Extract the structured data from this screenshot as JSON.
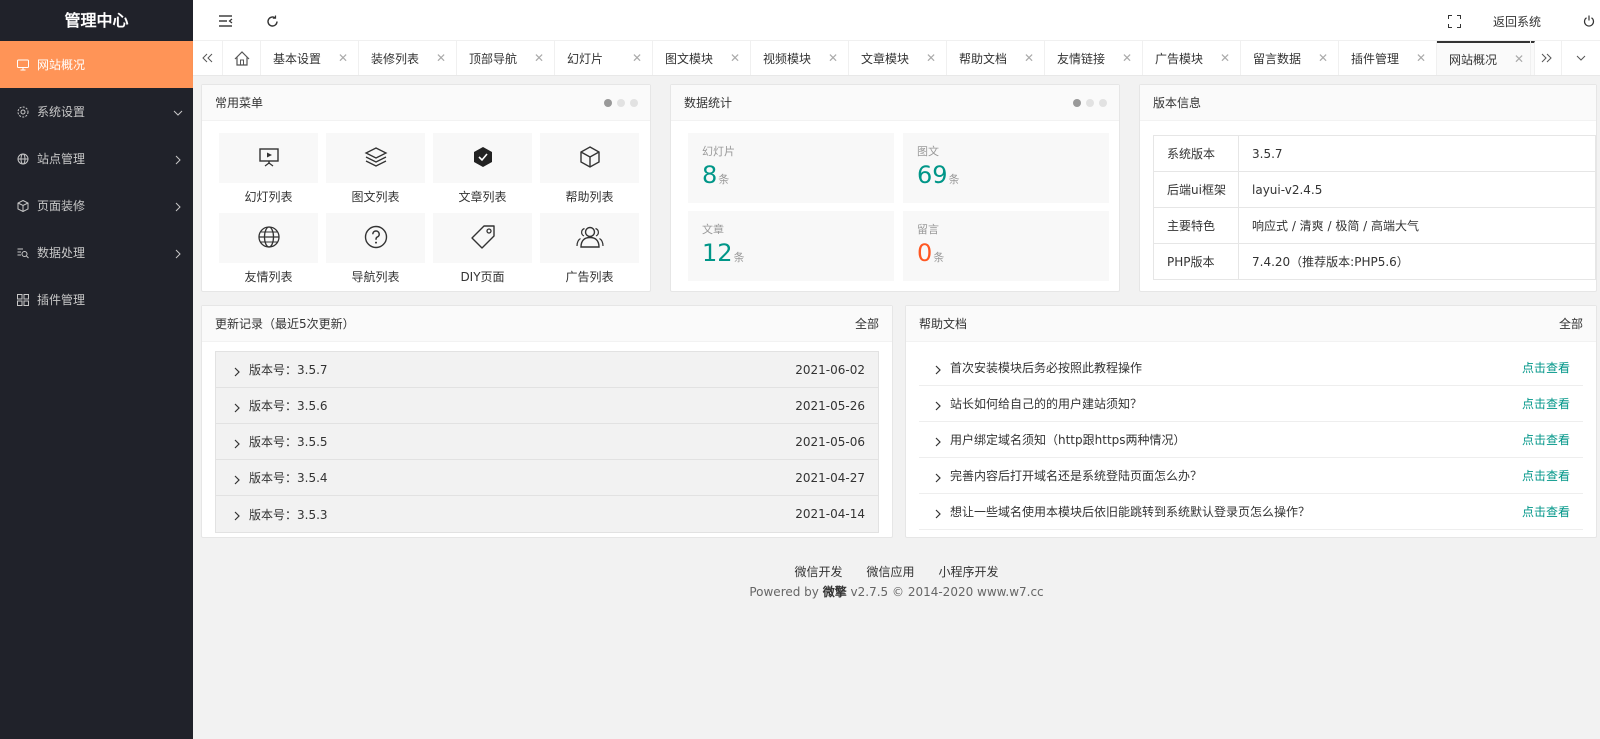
{
  "app": {
    "title": "管理中心"
  },
  "sidebar": {
    "items": [
      {
        "label": "网站概况",
        "icon": "monitor-icon",
        "active": true
      },
      {
        "label": "系统设置",
        "icon": "gear-icon",
        "expand": "down"
      },
      {
        "label": "站点管理",
        "icon": "globe-icon",
        "expand": "right"
      },
      {
        "label": "页面装修",
        "icon": "box-icon",
        "expand": "right"
      },
      {
        "label": "数据处理",
        "icon": "data-search-icon",
        "expand": "right"
      },
      {
        "label": "插件管理",
        "icon": "apps-icon"
      }
    ]
  },
  "header": {
    "return_label": "返回系统"
  },
  "tabs": [
    {
      "label": "基本设置"
    },
    {
      "label": "装修列表"
    },
    {
      "label": "顶部导航"
    },
    {
      "label": "幻灯片"
    },
    {
      "label": "图文模块"
    },
    {
      "label": "视频模块"
    },
    {
      "label": "文章模块"
    },
    {
      "label": "帮助文档"
    },
    {
      "label": "友情链接"
    },
    {
      "label": "广告模块"
    },
    {
      "label": "留言数据"
    },
    {
      "label": "插件管理"
    },
    {
      "label": "网站概况",
      "active": true
    }
  ],
  "menu_card": {
    "title": "常用菜单",
    "items": [
      {
        "label": "幻灯列表",
        "icon": "slideshow-icon"
      },
      {
        "label": "图文列表",
        "icon": "layers-icon"
      },
      {
        "label": "文章列表",
        "icon": "hexagon-check-icon"
      },
      {
        "label": "帮助列表",
        "icon": "cube-icon"
      },
      {
        "label": "友情列表",
        "icon": "globe-icon"
      },
      {
        "label": "导航列表",
        "icon": "question-circle-icon"
      },
      {
        "label": "DIY页面",
        "icon": "tag-icon"
      },
      {
        "label": "广告列表",
        "icon": "users-icon"
      }
    ]
  },
  "stats_card": {
    "title": "数据统计",
    "unit": "条",
    "items": [
      {
        "label": "幻灯片",
        "value": "8",
        "color": "#009688"
      },
      {
        "label": "图文",
        "value": "69",
        "color": "#009688"
      },
      {
        "label": "文章",
        "value": "12",
        "color": "#009688"
      },
      {
        "label": "留言",
        "value": "0",
        "color": "#ff5722"
      }
    ]
  },
  "version_card": {
    "title": "版本信息",
    "rows": [
      {
        "key": "系统版本",
        "value": "3.5.7"
      },
      {
        "key": "后端ui框架",
        "value": "layui-v2.4.5"
      },
      {
        "key": "主要特色",
        "value": "响应式 / 清爽 / 极简 / 高端大气"
      },
      {
        "key": "PHP版本",
        "value": "7.4.20（推荐版本:PHP5.6）"
      }
    ]
  },
  "updates_card": {
    "title": "更新记录（最近5次更新）",
    "more": "全部",
    "rows": [
      {
        "version": "版本号：3.5.7",
        "date": "2021-06-02"
      },
      {
        "version": "版本号：3.5.6",
        "date": "2021-05-26"
      },
      {
        "version": "版本号：3.5.5",
        "date": "2021-05-06"
      },
      {
        "version": "版本号：3.5.4",
        "date": "2021-04-27"
      },
      {
        "version": "版本号：3.5.3",
        "date": "2021-04-14"
      }
    ]
  },
  "help_card": {
    "title": "帮助文档",
    "more": "全部",
    "link_label": "点击查看",
    "rows": [
      {
        "text": "首次安装模块后务必按照此教程操作"
      },
      {
        "text": "站长如何给自己的的用户建站须知？"
      },
      {
        "text": "用户绑定域名须知（http跟https两种情况）"
      },
      {
        "text": "完善内容后打开域名还是系统登陆页面怎么办？"
      },
      {
        "text": "想让一些域名使用本模块后依旧能跳转到系统默认登录页怎么操作？"
      }
    ]
  },
  "footer": {
    "links": [
      "微信开发",
      "微信应用",
      "小程序开发"
    ],
    "powered_prefix": "Powered by ",
    "brand": "微擎",
    "powered_suffix": " v2.7.5 © 2014-2020 www.w7.cc"
  },
  "colors": {
    "sidebar_bg": "#20222a",
    "active_orange": "#ff9457",
    "accent_teal": "#009688",
    "alert_red": "#ff5722"
  }
}
